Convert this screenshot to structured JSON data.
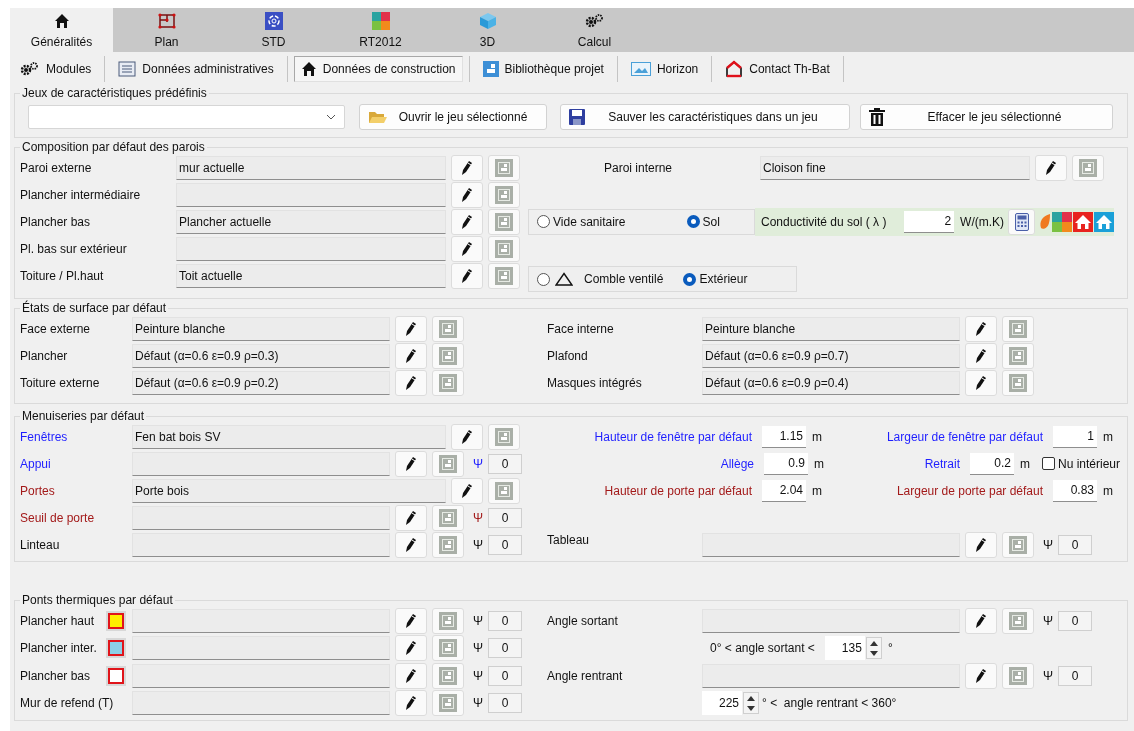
{
  "main_tabs": [
    {
      "label": "Généralités",
      "selected": true
    },
    {
      "label": "Plan",
      "selected": false
    },
    {
      "label": "STD",
      "selected": false
    },
    {
      "label": "RT2012",
      "selected": false
    },
    {
      "label": "3D",
      "selected": false
    },
    {
      "label": "Calcul",
      "selected": false
    }
  ],
  "toolbar": [
    {
      "label": "Modules",
      "selected": false
    },
    {
      "label": "Données administratives",
      "selected": false
    },
    {
      "label": "Données de construction",
      "selected": true
    },
    {
      "label": "Bibliothèque projet",
      "selected": false
    },
    {
      "label": "Horizon",
      "selected": false
    },
    {
      "label": "Contact Th-Bat",
      "selected": false
    }
  ],
  "presets": {
    "title": "Jeux de caractéristiques prédéfinis",
    "buttons": [
      "Ouvrir le jeu sélectionné",
      "Sauver les caractéristiques dans un jeu",
      "Effacer le jeu sélectionné"
    ]
  },
  "walls": {
    "title": "Composition par défaut des parois",
    "rows": [
      {
        "label": "Paroi externe",
        "value": "mur actuelle"
      },
      {
        "label": "Plancher intermédiaire"
      },
      {
        "label": "Plancher bas",
        "value": "Plancher actuelle"
      },
      {
        "label": "Pl. bas sur extérieur"
      },
      {
        "label": "Toiture / Pl.haut",
        "value": "Toit actuelle"
      }
    ],
    "internal": {
      "label": "Paroi interne",
      "value": "Cloison fine"
    },
    "floor_options": [
      {
        "label": "Vide sanitaire",
        "selected": false
      },
      {
        "label": "Sol",
        "selected": true
      }
    ],
    "ground": {
      "label": "Conductivité du sol ( λ )",
      "value": "2",
      "unit": "W/(m.K)"
    },
    "roof_options": [
      {
        "label": "Comble ventilé",
        "selected": false
      },
      {
        "label": "Extérieur",
        "selected": true
      }
    ]
  },
  "surfaces": {
    "title": "États de surface par défaut",
    "left": [
      {
        "label": "Face externe",
        "value": "Peinture blanche"
      },
      {
        "label": "Plancher",
        "value": "Défaut (α=0.6 ε=0.9 ρ=0.3)"
      },
      {
        "label": "Toiture externe",
        "value": "Défaut (α=0.6 ε=0.9 ρ=0.2)"
      }
    ],
    "right": [
      {
        "label": "Face interne",
        "value": "Peinture blanche"
      },
      {
        "label": "Plafond",
        "value": "Défaut (α=0.6 ε=0.9 ρ=0.7)"
      },
      {
        "label": "Masques intégrés",
        "value": "Défaut (α=0.6 ε=0.9 ρ=0.4)"
      }
    ]
  },
  "joinery": {
    "title": "Menuiseries par défaut",
    "rows": [
      {
        "label": "Fenêtres",
        "value": "Fen bat bois SV",
        "color": "#1f1fff",
        "dims": [
          {
            "label": "Hauteur de fenêtre par défaut",
            "value": "1.15",
            "unit": "m",
            "color": "#1f1fff"
          },
          {
            "label": "Largeur de fenêtre par défaut",
            "value": "1",
            "unit": "m",
            "color": "#1f1fff"
          }
        ]
      },
      {
        "label": "Appui",
        "color": "#1f1fff",
        "psi_label": "Ψ",
        "psi": "0",
        "dims": [
          {
            "label": "Allège",
            "value": "0.9",
            "unit": "m",
            "color": "#1f1fff"
          },
          {
            "label": "Retrait",
            "value": "0.2",
            "unit": "m",
            "color": "#1f1fff"
          }
        ],
        "checkbox": {
          "label": "Nu intérieur",
          "checked": false
        }
      },
      {
        "label": "Portes",
        "value": "Porte bois",
        "color": "#a31a1a",
        "dims": [
          {
            "label": "Hauteur de porte par défaut",
            "value": "2.04",
            "unit": "m",
            "color": "#a31a1a"
          },
          {
            "label": "Largeur de porte par défaut",
            "value": "0.83",
            "unit": "m",
            "color": "#a31a1a"
          }
        ]
      },
      {
        "label": "Seuil de porte",
        "color": "#a31a1a",
        "psi_label": "Ψ",
        "psi": "0"
      },
      {
        "label": "Linteau",
        "color": "#111111",
        "psi_label": "Ψ",
        "psi": "0",
        "right": {
          "label": "Tableau",
          "psi_label": "Ψ",
          "psi": "0"
        }
      }
    ]
  },
  "thermal_bridges": {
    "title": "Ponts thermiques par défaut",
    "rows": [
      {
        "label": "Plancher haut",
        "color": "#ffee00",
        "psi_label": "Ψ",
        "psi": "0",
        "right": {
          "kind": "field",
          "label": "Angle sortant",
          "psi_label": "Ψ",
          "psi": "0"
        }
      },
      {
        "label": "Plancher inter.",
        "color": "#8ccfe6",
        "psi_label": "Ψ",
        "psi": "0",
        "right": {
          "kind": "spin_after",
          "before": "0° < angle sortant <",
          "value": "135",
          "after": "°"
        }
      },
      {
        "label": "Plancher bas",
        "color": "#ffffff",
        "psi_label": "Ψ",
        "psi": "0",
        "right": {
          "kind": "field",
          "label": "Angle rentrant",
          "psi_label": "Ψ",
          "psi": "0"
        }
      },
      {
        "label": "Mur de refend (T)",
        "psi_label": "Ψ",
        "psi": "0",
        "right": {
          "kind": "spin_before",
          "value": "225",
          "after": "° <  angle rentrant < 360°"
        }
      }
    ]
  }
}
